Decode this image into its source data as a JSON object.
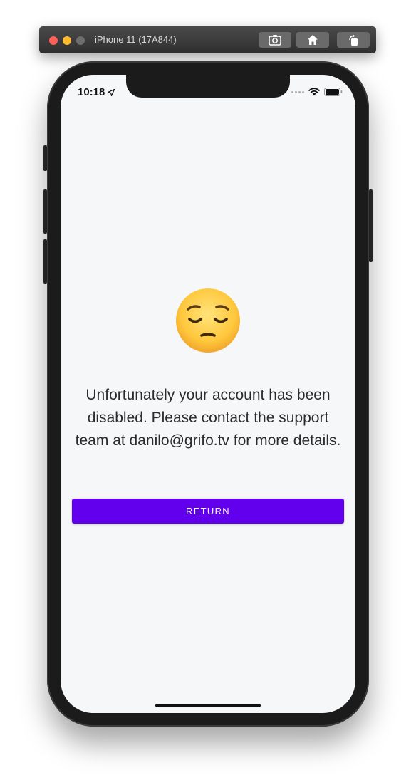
{
  "simulator": {
    "title": "iPhone 11 (17A844)",
    "buttons": [
      "screenshot-icon",
      "home-icon",
      "rotate-icon"
    ]
  },
  "status_bar": {
    "time": "10:18",
    "icons": [
      "location-arrow-icon",
      "cellular-signal-icon",
      "wifi-icon",
      "battery-icon"
    ]
  },
  "main": {
    "emoji": "pensive-face-emoji",
    "message": "Unfortunately your account has been disabled. Please contact the support team at danilo@grifo.tv for more details.",
    "return_label": "RETURN"
  },
  "colors": {
    "accent": "#6200ee",
    "background": "#f6f7f9",
    "text": "#2b2b2b"
  }
}
